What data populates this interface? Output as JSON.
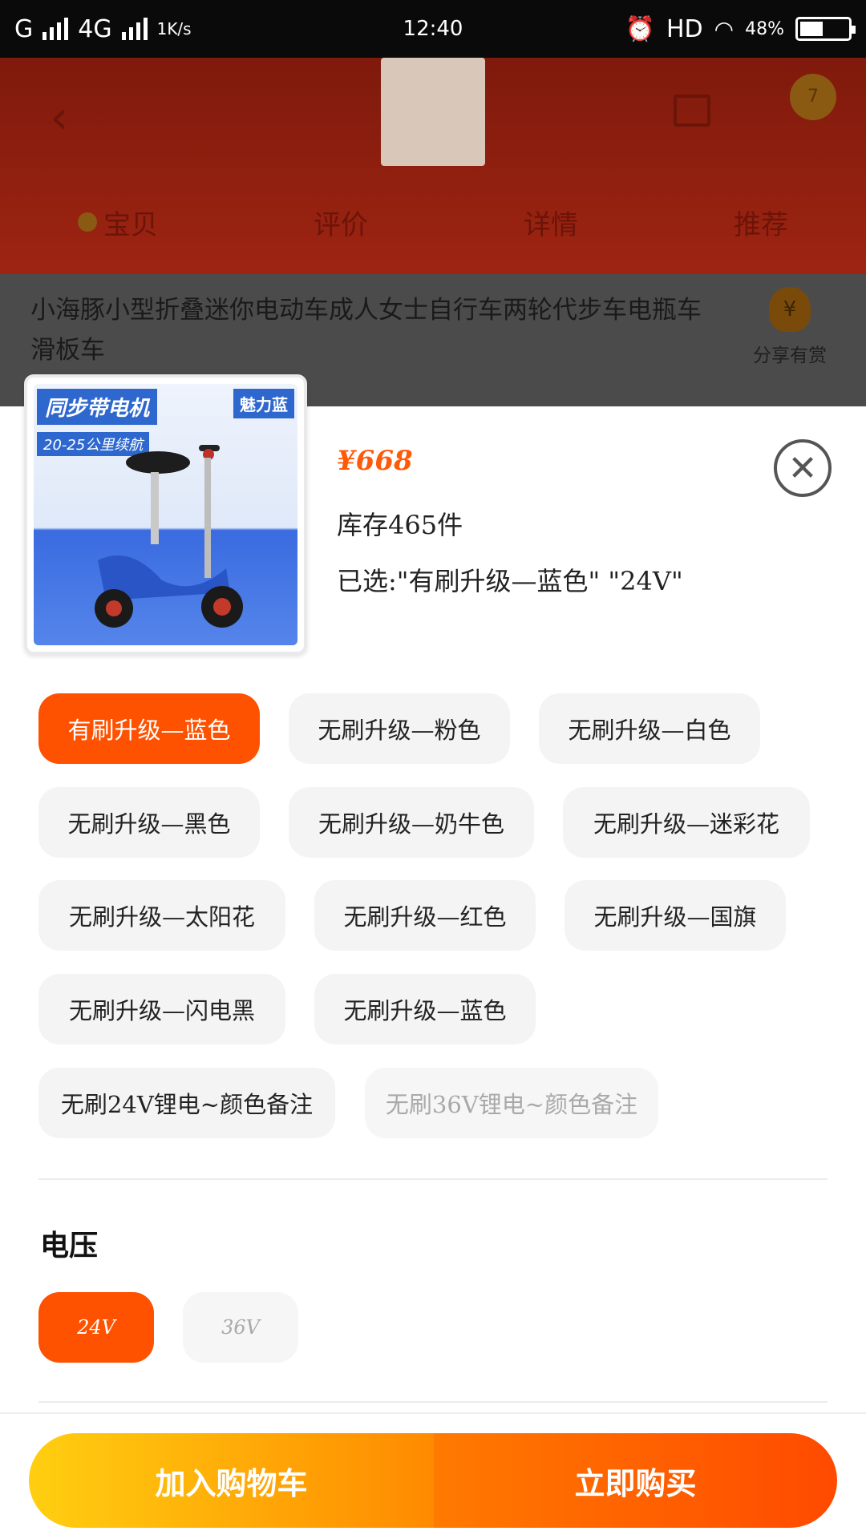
{
  "status_bar": {
    "network_1": "G",
    "network_2": "4G",
    "speed": "1K/s",
    "time": "12:40",
    "hd": "HD",
    "battery_percent": "48%"
  },
  "background_page": {
    "tabs": [
      "宝贝",
      "评价",
      "详情",
      "推荐"
    ],
    "product_title": "小海豚小型折叠迷你电动车成人女士自行车两轮代步车电瓶车滑板车",
    "share_label": "分享有赏",
    "cart_badge": "7"
  },
  "product_image": {
    "headline": "同步带电机",
    "subline": "20-25公里续航",
    "badge": "魅力蓝"
  },
  "sku": {
    "price": "¥668",
    "stock": "库存465件",
    "selected": "已选:\"有刷升级—蓝色\" \"24V\""
  },
  "colors": [
    "有刷升级—蓝色",
    "无刷升级—粉色",
    "无刷升级—白色",
    "无刷升级—黑色",
    "无刷升级—奶牛色",
    "无刷升级—迷彩花",
    "无刷升级—太阳花",
    "无刷升级—红色",
    "无刷升级—国旗",
    "无刷升级—闪电黑",
    "无刷升级—蓝色",
    "无刷24V锂电~颜色备注",
    "无刷36V锂电~颜色备注"
  ],
  "voltage": {
    "label": "电压",
    "options": [
      "24V",
      "36V"
    ]
  },
  "actions": {
    "add_to_cart": "加入购物车",
    "buy_now": "立即购买"
  },
  "theme": {
    "accent": "#ff5200",
    "cart_gradient": [
      "#ffcf10",
      "#ff8a00"
    ],
    "buy_gradient": [
      "#ff7a00",
      "#ff4a00"
    ]
  }
}
